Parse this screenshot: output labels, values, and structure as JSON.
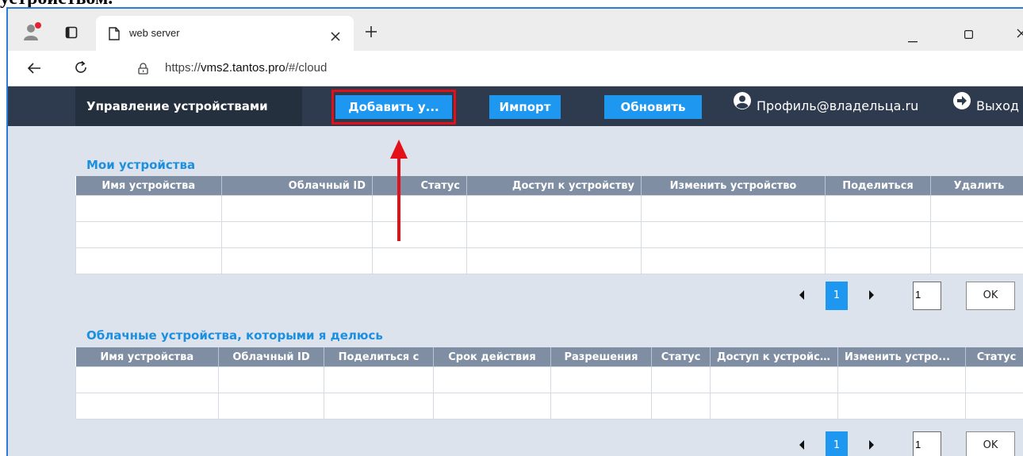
{
  "caption": "устройством.",
  "browser": {
    "tab_title": "web server",
    "url_prefix": "https://",
    "url_host": "vms2.tantos.pro",
    "url_path": "/#/cloud",
    "icons": [
      "profile-icon",
      "tab-actions-icon",
      "page-icon",
      "close-icon",
      "new-tab-icon",
      "minimize-icon",
      "maximize-icon",
      "window-close-icon",
      "back-icon",
      "reload-icon",
      "lock-icon"
    ]
  },
  "app": {
    "brand": "Управление устройствами",
    "add_button": "Добавить у...",
    "import_button": "Импорт",
    "refresh_button": "Обновить",
    "profile": "Профиль@владельца.ru",
    "logout": "Выход"
  },
  "my_devices": {
    "title": "Мои устройства",
    "columns": [
      "Имя устройства",
      "Облачный ID",
      "Статус",
      "Доступ к устройству",
      "Изменить устройство",
      "Поделиться",
      "Удалить"
    ],
    "row_count": 3,
    "pager": {
      "current": "1",
      "input": "1",
      "ok": "OK"
    }
  },
  "shared_devices": {
    "title": "Облачные устройства, которыми я делюсь",
    "columns": [
      "Имя устройства",
      "Облачный ID",
      "Поделиться с",
      "Срок действия",
      "Разрешения",
      "Статус",
      "Доступ к устройс...",
      "Изменить устро...",
      "Статус"
    ],
    "row_count": 2,
    "pager": {
      "current": "1",
      "input": "1",
      "ok": "OK"
    }
  },
  "colors": {
    "accent": "#1d97f0",
    "header": "#2e3a4d",
    "highlight": "#e3101a"
  }
}
